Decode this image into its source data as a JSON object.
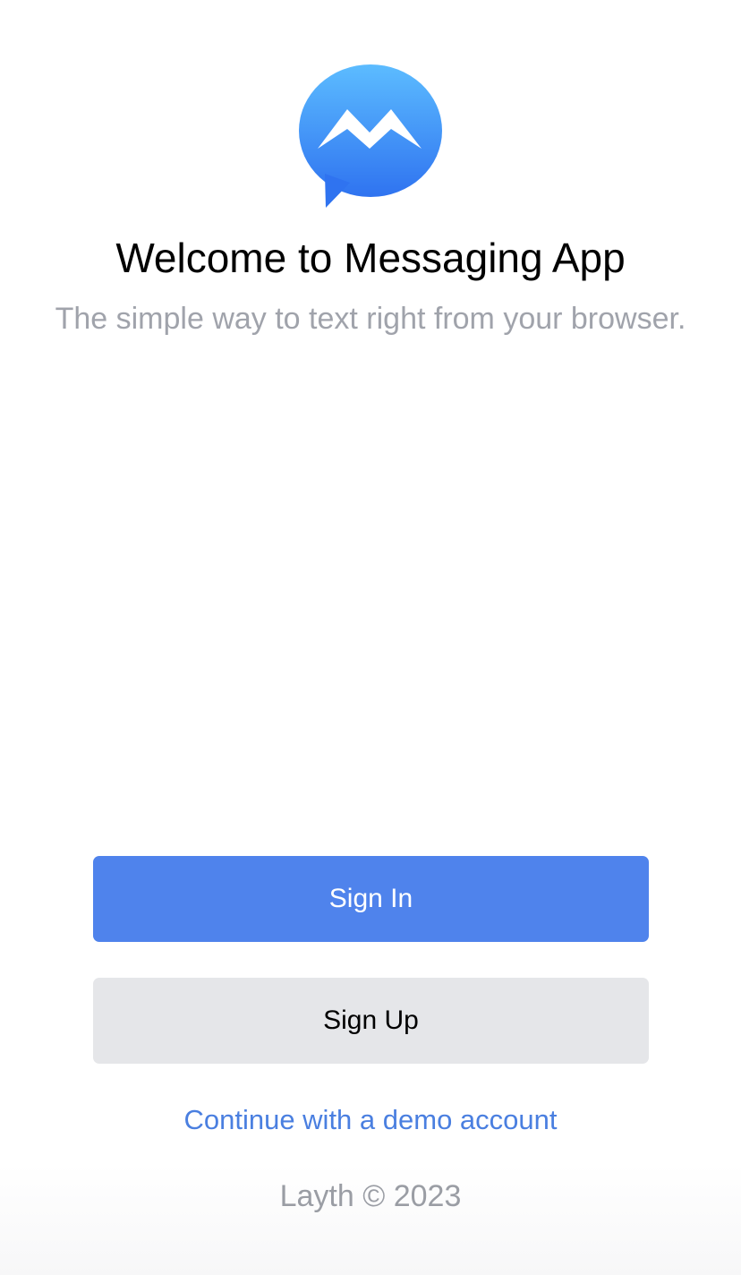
{
  "header": {
    "logo_icon": "messenger-bubble-icon",
    "title": "Welcome to Messaging App",
    "subtitle": "The simple way to text right from your browser."
  },
  "actions": {
    "sign_in_label": "Sign In",
    "sign_up_label": "Sign Up",
    "demo_link_label": "Continue with a demo account"
  },
  "footer": {
    "text": "Layth © 2023"
  },
  "colors": {
    "primary": "#4f83ec",
    "secondary": "#e5e6e9",
    "link": "#4a7fe0",
    "logo_top": "#5cbcff",
    "logo_bottom": "#2f73f0"
  }
}
